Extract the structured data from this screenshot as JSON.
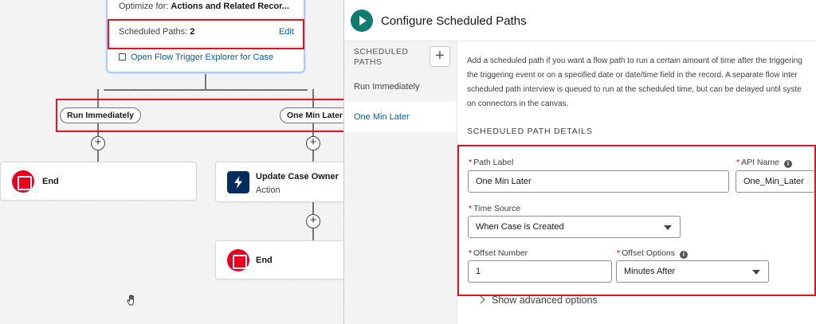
{
  "canvas": {
    "start": {
      "optimize_label": "Optimize for:",
      "optimize_value": "Actions and Related Recor...",
      "scheduled_paths_label": "Scheduled Paths:",
      "scheduled_paths_value": "2",
      "edit_link": "Edit",
      "explorer_link": "Open Flow Trigger Explorer for Case"
    },
    "paths": [
      {
        "label": "Run Immediately"
      },
      {
        "label": "One Min Later"
      }
    ],
    "nodes": {
      "end_1": {
        "title": "End"
      },
      "update_case_owner": {
        "title": "Update Case Owner",
        "subtitle": "Action"
      },
      "end_2": {
        "title": "End"
      }
    }
  },
  "panel": {
    "title": "Configure Scheduled Paths",
    "left_nav": {
      "heading": "SCHEDULED PATHS",
      "add_symbol": "+",
      "items": [
        {
          "label": "Run Immediately",
          "active": false
        },
        {
          "label": "One Min Later",
          "active": true
        }
      ]
    },
    "description_lines": [
      "Add a scheduled path if you want a flow path to run a certain amount of time after the triggering",
      "the triggering event or on a specified date or date/time field in the record. A separate flow inter",
      "scheduled path interview is queued to run at the scheduled time, but can be delayed until syste",
      "on connectors in the canvas."
    ],
    "section_heading": "SCHEDULED PATH DETAILS",
    "fields": {
      "path_label": {
        "label": "Path Label",
        "value": "One Min Later"
      },
      "api_name": {
        "label": "API Name",
        "value": "One_Min_Later"
      },
      "time_source": {
        "label": "Time Source",
        "value": "When Case is Created"
      },
      "offset_number": {
        "label": "Offset Number",
        "value": "1"
      },
      "offset_options": {
        "label": "Offset Options",
        "value": "Minutes After"
      }
    },
    "advanced_link": "Show advanced options"
  },
  "colors": {
    "highlight": "#e0141e",
    "link": "#0b5cab",
    "end_icon": "#ea001e",
    "action_icon": "#032d60",
    "play_icon": "#0c7d6e"
  }
}
